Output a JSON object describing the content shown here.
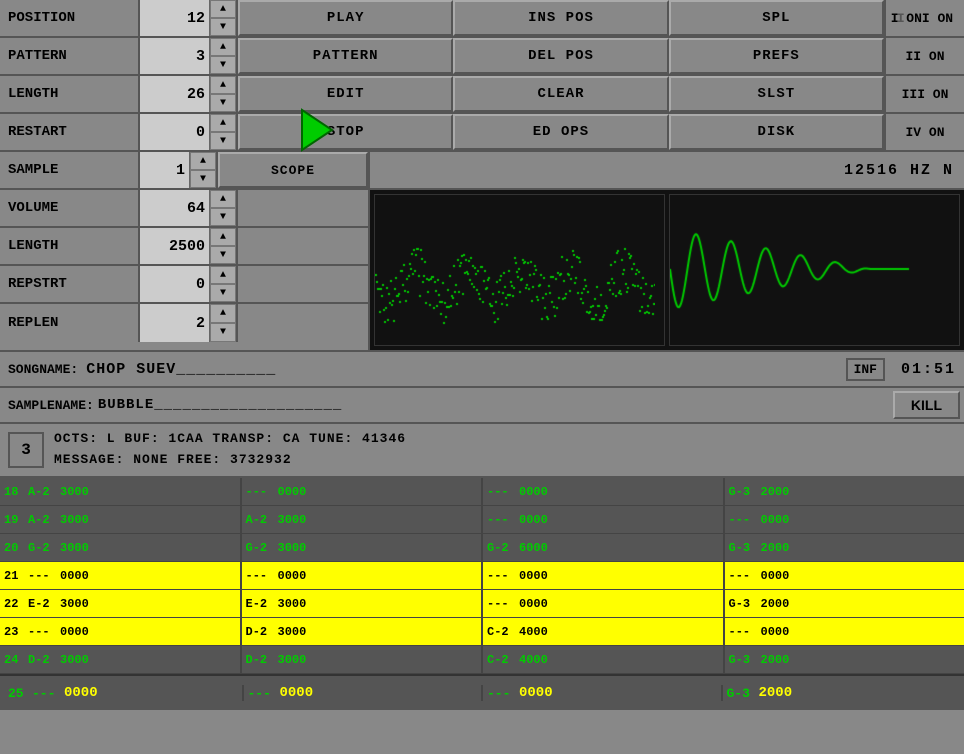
{
  "header": {
    "rows": [
      {
        "label": "POSITION",
        "value": "12",
        "buttons": [
          "PLAY",
          "INS POS",
          "SPL"
        ],
        "on": "I ON"
      },
      {
        "label": "PATTERN",
        "value": "3",
        "buttons": [
          "PATTERN",
          "DEL POS",
          "PREFS"
        ],
        "on": "II ON"
      },
      {
        "label": "LENGTH",
        "value": "26",
        "buttons": [
          "EDIT",
          "CLEAR",
          "SLST"
        ],
        "on": "III ON"
      },
      {
        "label": "RESTART",
        "value": "0",
        "buttons": [
          "STOP",
          "ED OPS",
          "DISK"
        ],
        "on": "IV ON"
      }
    ]
  },
  "sample": {
    "label": "SAMPLE",
    "value": "1",
    "scope_btn": "SCOPE",
    "hz": "12516 HZ N"
  },
  "controls": [
    {
      "label": "VOLUME",
      "value": "64"
    },
    {
      "label": "LENGTH",
      "value": "2500"
    },
    {
      "label": "REPSTRT",
      "value": "0"
    },
    {
      "label": "REPLEN",
      "value": "2"
    }
  ],
  "songname": {
    "label": "SONGNAME:",
    "value": "CHOP SUEV__________",
    "inf": "INF",
    "time": "01:51"
  },
  "samplename": {
    "label": "SAMPLENAME:",
    "value": "BUBBLE____________________",
    "kill": "KILL"
  },
  "info": {
    "channel": "3",
    "line1": "OCTS: L   BUF: 1CAA TRANSP: CA TUNE:    41346",
    "line2": "MESSAGE: NONE                   FREE: 3732932"
  },
  "pattern": {
    "columns": [
      {
        "rows": [
          {
            "num": "18",
            "note": "A-2",
            "val": "3000",
            "highlight": false
          },
          {
            "num": "19",
            "note": "A-2",
            "val": "3000",
            "highlight": false
          },
          {
            "num": "20",
            "note": "G-2",
            "val": "3000",
            "highlight": false
          },
          {
            "num": "21",
            "note": "---",
            "val": "0000",
            "highlight": true
          },
          {
            "num": "22",
            "note": "E-2",
            "val": "3000",
            "highlight": true
          },
          {
            "num": "23",
            "note": "---",
            "val": "0000",
            "highlight": true
          },
          {
            "num": "24",
            "note": "D-2",
            "val": "3000",
            "highlight": false
          }
        ]
      },
      {
        "rows": [
          {
            "num": "",
            "note": "---",
            "val": "0000",
            "highlight": false
          },
          {
            "num": "",
            "note": "A-2",
            "val": "3000",
            "highlight": false
          },
          {
            "num": "",
            "note": "G-2",
            "val": "3000",
            "highlight": false
          },
          {
            "num": "",
            "note": "---",
            "val": "0000",
            "highlight": true
          },
          {
            "num": "",
            "note": "E-2",
            "val": "3000",
            "highlight": true
          },
          {
            "num": "",
            "note": "D-2",
            "val": "3000",
            "highlight": true
          },
          {
            "num": "",
            "note": "D-2",
            "val": "3000",
            "highlight": false
          }
        ]
      },
      {
        "rows": [
          {
            "num": "",
            "note": "---",
            "val": "0000",
            "highlight": false
          },
          {
            "num": "",
            "note": "---",
            "val": "0000",
            "highlight": false
          },
          {
            "num": "",
            "note": "G-2",
            "val": "6000",
            "highlight": false
          },
          {
            "num": "",
            "note": "---",
            "val": "0000",
            "highlight": true
          },
          {
            "num": "",
            "note": "---",
            "val": "0000",
            "highlight": true
          },
          {
            "num": "",
            "note": "C-2",
            "val": "4000",
            "highlight": true
          },
          {
            "num": "",
            "note": "C-2",
            "val": "4000",
            "highlight": false
          }
        ]
      },
      {
        "rows": [
          {
            "num": "",
            "note": "G-3",
            "val": "2000",
            "highlight": false
          },
          {
            "num": "",
            "note": "---",
            "val": "0000",
            "highlight": false
          },
          {
            "num": "",
            "note": "G-3",
            "val": "2000",
            "highlight": false
          },
          {
            "num": "",
            "note": "---",
            "val": "0000",
            "highlight": true
          },
          {
            "num": "",
            "note": "G-3",
            "val": "2000",
            "highlight": true
          },
          {
            "num": "",
            "note": "---",
            "val": "0000",
            "highlight": true
          },
          {
            "num": "",
            "note": "G-3",
            "val": "2000",
            "highlight": false
          }
        ]
      }
    ],
    "bottom": {
      "num": "25",
      "cols": [
        {
          "note": "---",
          "val": "0000"
        },
        {
          "note": "---",
          "val": "0000"
        },
        {
          "note": "---",
          "val": "0000"
        },
        {
          "note": "G-3",
          "val": "2000"
        }
      ]
    }
  },
  "icons": {
    "arrow_up": "▲",
    "arrow_down": "▼",
    "cursor": "▶"
  }
}
